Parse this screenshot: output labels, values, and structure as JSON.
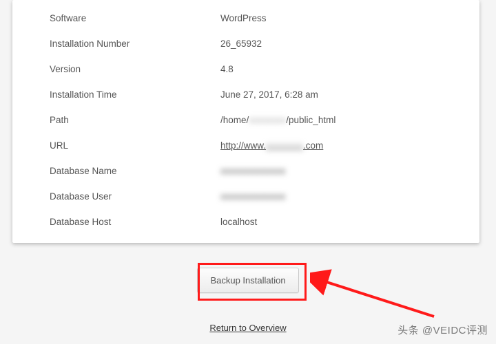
{
  "details": {
    "software": {
      "label": "Software",
      "value": "WordPress"
    },
    "install_number": {
      "label": "Installation Number",
      "value": "26_65932"
    },
    "version": {
      "label": "Version",
      "value": "4.8"
    },
    "install_time": {
      "label": "Installation Time",
      "value": "June 27, 2017, 6:28 am"
    },
    "path": {
      "label": "Path",
      "value_prefix": "/home/",
      "value_mid_obscured": "xxxxxxxx",
      "value_suffix": "/public_html"
    },
    "url": {
      "label": "URL",
      "value_prefix": "http://www.",
      "value_mid_obscured": "xxxxxxxx",
      "value_suffix": ".com",
      "href": "#"
    },
    "db_name": {
      "label": "Database Name",
      "value_obscured": "xxxxxxxxxxxxxx"
    },
    "db_user": {
      "label": "Database User",
      "value_obscured": "xxxxxxxxxxxxxx"
    },
    "db_host": {
      "label": "Database Host",
      "value": "localhost"
    }
  },
  "buttons": {
    "backup": "Backup Installation"
  },
  "links": {
    "return": "Return to Overview"
  },
  "watermark": "头条 @VEIDC评测"
}
